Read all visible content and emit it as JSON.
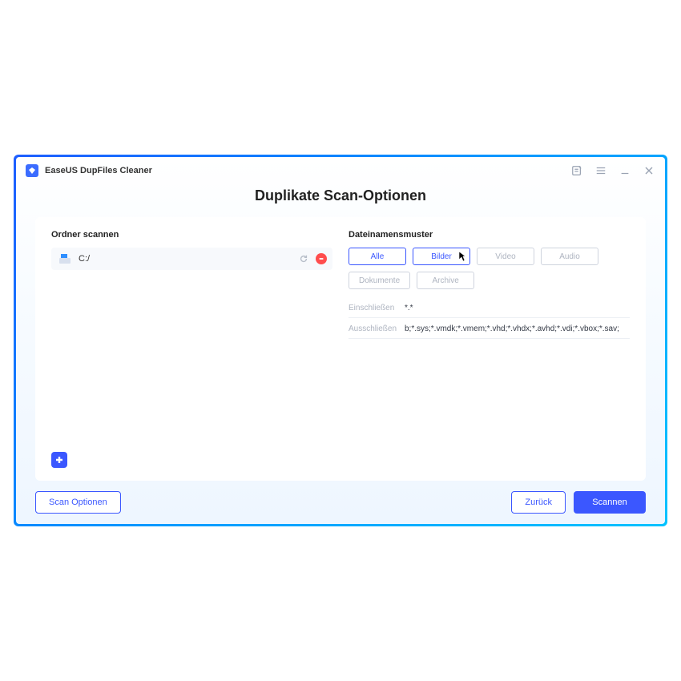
{
  "app": {
    "title": "EaseUS DupFiles Cleaner"
  },
  "page": {
    "heading": "Duplikate Scan-Optionen"
  },
  "left": {
    "label": "Ordner scannen",
    "folders": [
      {
        "path": "C:/"
      }
    ]
  },
  "right": {
    "label": "Dateinamensmuster",
    "filters": {
      "all": {
        "label": "Alle",
        "active": true
      },
      "images": {
        "label": "Bilder",
        "active": true
      },
      "video": {
        "label": "Video",
        "active": false
      },
      "audio": {
        "label": "Audio",
        "active": false
      },
      "docs": {
        "label": "Dokumente",
        "active": false
      },
      "arch": {
        "label": "Archive",
        "active": false
      }
    },
    "include": {
      "label": "Einschließen",
      "value": "*.*"
    },
    "exclude": {
      "label": "Ausschließen",
      "value": "b;*.sys;*.vmdk;*.vmem;*.vhd;*.vhdx;*.avhd;*.vdi;*.vbox;*.sav;"
    }
  },
  "footer": {
    "options": "Scan Optionen",
    "back": "Zurück",
    "scan": "Scannen"
  }
}
